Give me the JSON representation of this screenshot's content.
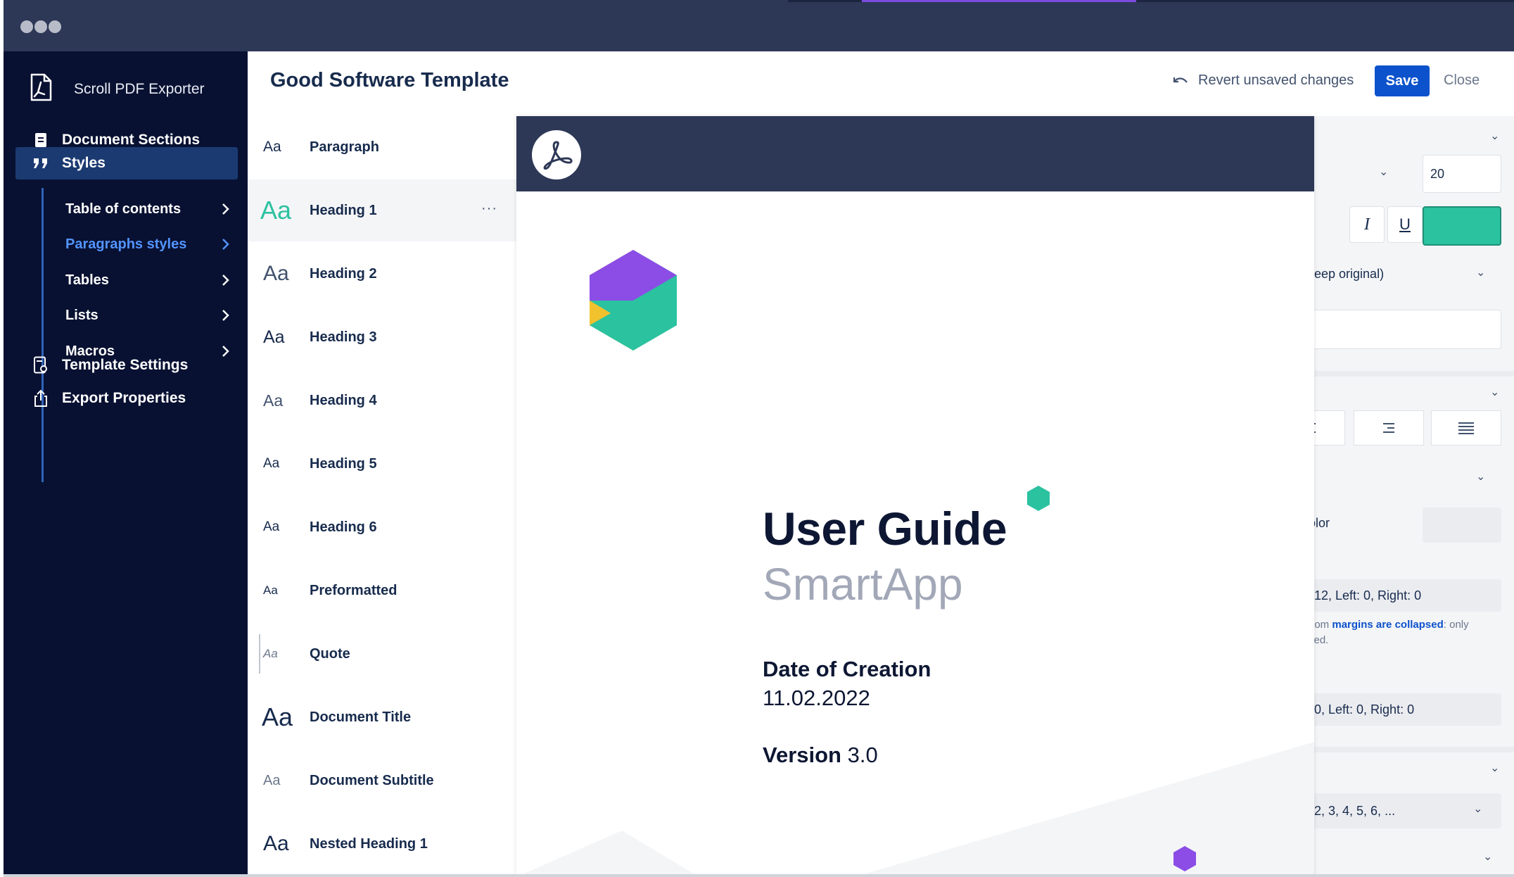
{
  "app": {
    "name": "Scroll PDF Exporter"
  },
  "sidebar": {
    "sections": [
      {
        "label": "Document Sections",
        "icon": "document-icon"
      },
      {
        "label": "Styles",
        "icon": "quote-icon"
      },
      {
        "label": "Template Settings",
        "icon": "template-settings-icon"
      },
      {
        "label": "Export Properties",
        "icon": "export-icon"
      }
    ],
    "sub_items": [
      {
        "label": "Table of contents"
      },
      {
        "label": "Paragraphs styles"
      },
      {
        "label": "Tables"
      },
      {
        "label": "Lists"
      },
      {
        "label": "Macros"
      }
    ]
  },
  "header": {
    "title": "Good Software Template",
    "revert_label": "Revert unsaved changes",
    "save_label": "Save",
    "close_label": "Close"
  },
  "styles": [
    {
      "sample": "Aa",
      "name": "Paragraph"
    },
    {
      "sample": "Aa",
      "name": "Heading 1",
      "more": "···"
    },
    {
      "sample": "Aa",
      "name": "Heading 2"
    },
    {
      "sample": "Aa",
      "name": "Heading 3"
    },
    {
      "sample": "Aa",
      "name": "Heading 4"
    },
    {
      "sample": "Aa",
      "name": "Heading 5"
    },
    {
      "sample": "Aa",
      "name": "Heading 6"
    },
    {
      "sample": "Aa",
      "name": "Preformatted"
    },
    {
      "sample": "Aa",
      "name": "Quote"
    },
    {
      "sample": "Aa",
      "name": "Document Title"
    },
    {
      "sample": "Aa",
      "name": "Document Subtitle"
    },
    {
      "sample": "Aa",
      "name": "Nested Heading 1"
    }
  ],
  "settings": {
    "font_size": "20",
    "italic_glyph": "I",
    "underline_glyph": "U",
    "color_swatch": "#2bc2a0",
    "case_option": "eep original)",
    "color_label": "olor",
    "margins_text": "12, Left: 0, Right: 0",
    "note_lead": "ttom",
    "note_link": "margins are collapsed",
    "note_tail": ": only",
    "note_line2": "sed.",
    "padding_text": "0, Left: 0, Right: 0",
    "numbering_text": "2, 3, 4, 5, 6, ..."
  },
  "preview": {
    "title": "User Guide",
    "subtitle": "SmartApp",
    "date_label": "Date of Creation",
    "date_value": "11.02.2022",
    "version_label": "Version",
    "version_value": "3.0"
  },
  "colors": {
    "accent": "#0c52cc",
    "sidebar_bg": "#081132",
    "teal": "#2bc2a0",
    "purple": "#8b4de6",
    "yellow": "#f2c12e"
  }
}
